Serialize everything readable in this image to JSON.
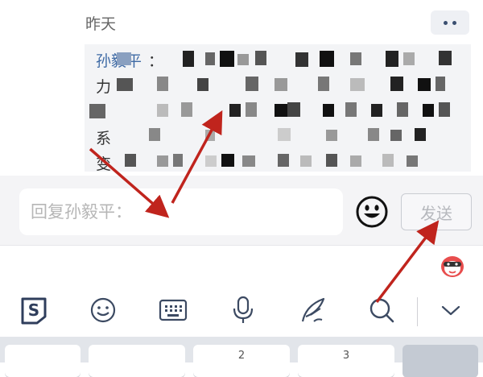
{
  "comment": {
    "date": "昨天",
    "quote": {
      "author": "孙毅平",
      "line1": "：",
      "line2": "力",
      "line3": "",
      "line4": "系",
      "line5": "变"
    }
  },
  "input_bar": {
    "reply_placeholder": "回复孙毅平：",
    "send_label": "发送"
  },
  "keyboard": {
    "keys": [
      "",
      "",
      "2",
      "3",
      ""
    ]
  },
  "colors": {
    "annotation_arrow": "#c0241d",
    "link_name": "#3e6aa5",
    "send_border": "#c9ccd2"
  },
  "icons": {
    "more": "more-dots-icon",
    "emoji": "emoji-icon",
    "ime_logo": "sogou-logo-icon",
    "ime_emoji": "smiley-icon",
    "keyboard": "keyboard-icon",
    "voice": "microphone-icon",
    "handwrite": "handwrite-quill-icon",
    "search": "search-icon",
    "collapse": "chevron-down-icon",
    "mascot": "mascot-badge-icon"
  }
}
